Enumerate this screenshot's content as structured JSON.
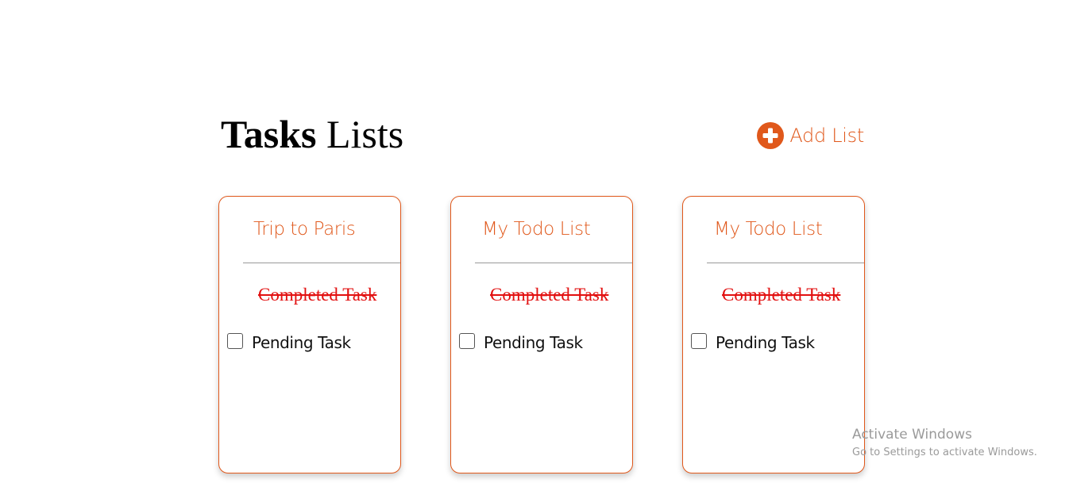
{
  "header": {
    "title_bold": "Tasks",
    "title_rest": "Lists",
    "add_list_label": "Add List",
    "add_list_icon": "plus-circle-icon"
  },
  "colors": {
    "accent": "#e0581b",
    "completed": "#e21010",
    "divider": "#9a9a9a"
  },
  "lists": [
    {
      "title": "Trip to Paris",
      "completed_task": "Completed Task",
      "pending_task": "Pending Task",
      "pending_checked": false
    },
    {
      "title": "My Todo List",
      "completed_task": "Completed Task",
      "pending_task": "Pending Task",
      "pending_checked": false
    },
    {
      "title": "My Todo List",
      "completed_task": "Completed Task",
      "pending_task": "Pending Task",
      "pending_checked": false
    }
  ],
  "watermark": {
    "title": "Activate Windows",
    "subtitle": "Go to Settings to activate Windows."
  }
}
